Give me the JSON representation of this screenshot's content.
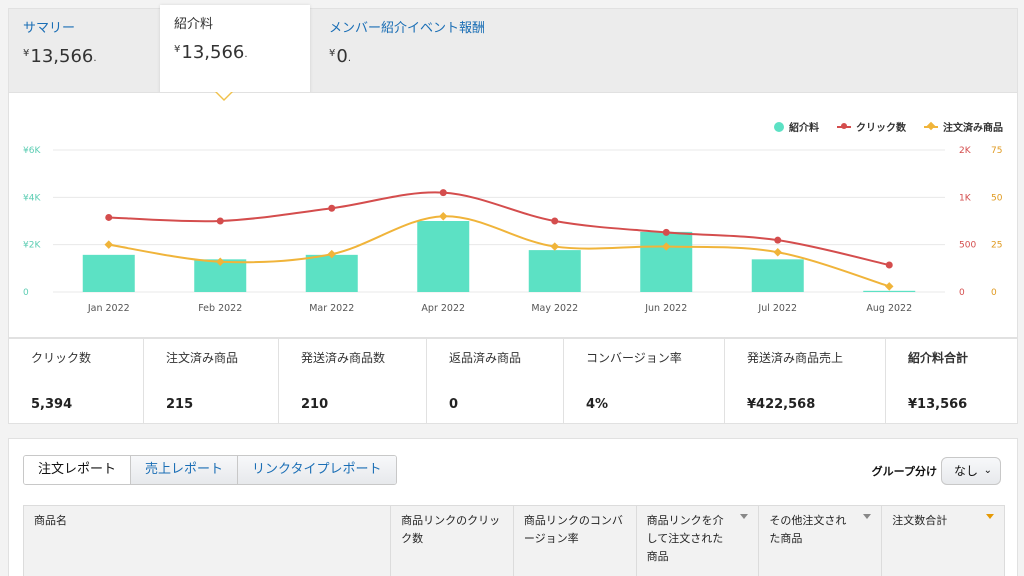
{
  "summary_tabs": [
    {
      "label": "サマリー",
      "currency": "¥",
      "value": "13,566",
      "suffix": "·"
    },
    {
      "label": "紹介料",
      "currency": "¥",
      "value": "13,566",
      "suffix": "·"
    },
    {
      "label": "メンバー紹介イベント報酬",
      "currency": "¥",
      "value": "0",
      "suffix": "·"
    }
  ],
  "chart_data": {
    "type": "bar",
    "categories": [
      "Jan 2022",
      "Feb 2022",
      "Mar 2022",
      "Apr 2022",
      "May 2022",
      "Jun 2022",
      "Jul 2022",
      "Aug 2022"
    ],
    "series": [
      {
        "name": "紹介料",
        "type": "bar",
        "axis": "left",
        "color": "#5ce1c4",
        "values": [
          1570,
          1380,
          1570,
          3000,
          1770,
          2540,
          1380,
          50
        ]
      },
      {
        "name": "クリック数",
        "type": "line",
        "axis": "right1",
        "color": "#d44d4d",
        "values": [
          1050,
          1000,
          1180,
          1400,
          1000,
          840,
          730,
          380
        ]
      },
      {
        "name": "注文済み商品",
        "type": "line",
        "axis": "right2",
        "color": "#f0b43a",
        "values": [
          25,
          16,
          20,
          40,
          24,
          24,
          21,
          3
        ]
      }
    ],
    "y_left": {
      "ticks": [
        "0",
        "¥2K",
        "¥4K",
        "¥6K"
      ],
      "range": [
        0,
        6000
      ]
    },
    "y_right1": {
      "ticks": [
        "0",
        "500",
        "1K",
        "2K"
      ],
      "range": [
        0,
        2000
      ]
    },
    "y_right2": {
      "ticks": [
        "0",
        "25",
        "50",
        "75"
      ],
      "range": [
        0,
        75
      ]
    },
    "legend": [
      "紹介料",
      "クリック数",
      "注文済み商品"
    ],
    "legend_position": "top-right",
    "grid": true
  },
  "metrics": [
    {
      "label": "クリック数",
      "value": "5,394"
    },
    {
      "label": "注文済み商品",
      "value": "215"
    },
    {
      "label": "発送済み商品数",
      "value": "210"
    },
    {
      "label": "返品済み商品",
      "value": "0"
    },
    {
      "label": "コンバージョン率",
      "value": "4%"
    },
    {
      "label": "発送済み商品売上",
      "value": "¥422,568"
    },
    {
      "label": "紹介料合計",
      "value": "¥13,566"
    }
  ],
  "report_tabs": [
    "注文レポート",
    "売上レポート",
    "リンクタイプレポート"
  ],
  "group": {
    "label": "グループ分け",
    "value": "なし"
  },
  "table_headers": [
    "商品名",
    "商品リンクのクリック数",
    "商品リンクのコンバージョン率",
    "商品リンクを介して注文された商品",
    "その他注文された商品",
    "注文数合計"
  ],
  "colors": {
    "link": "#1a6eb5",
    "bar": "#5ce1c4",
    "clicks": "#d44d4d",
    "orders": "#f0b43a",
    "sort_active": "#e69a06"
  }
}
